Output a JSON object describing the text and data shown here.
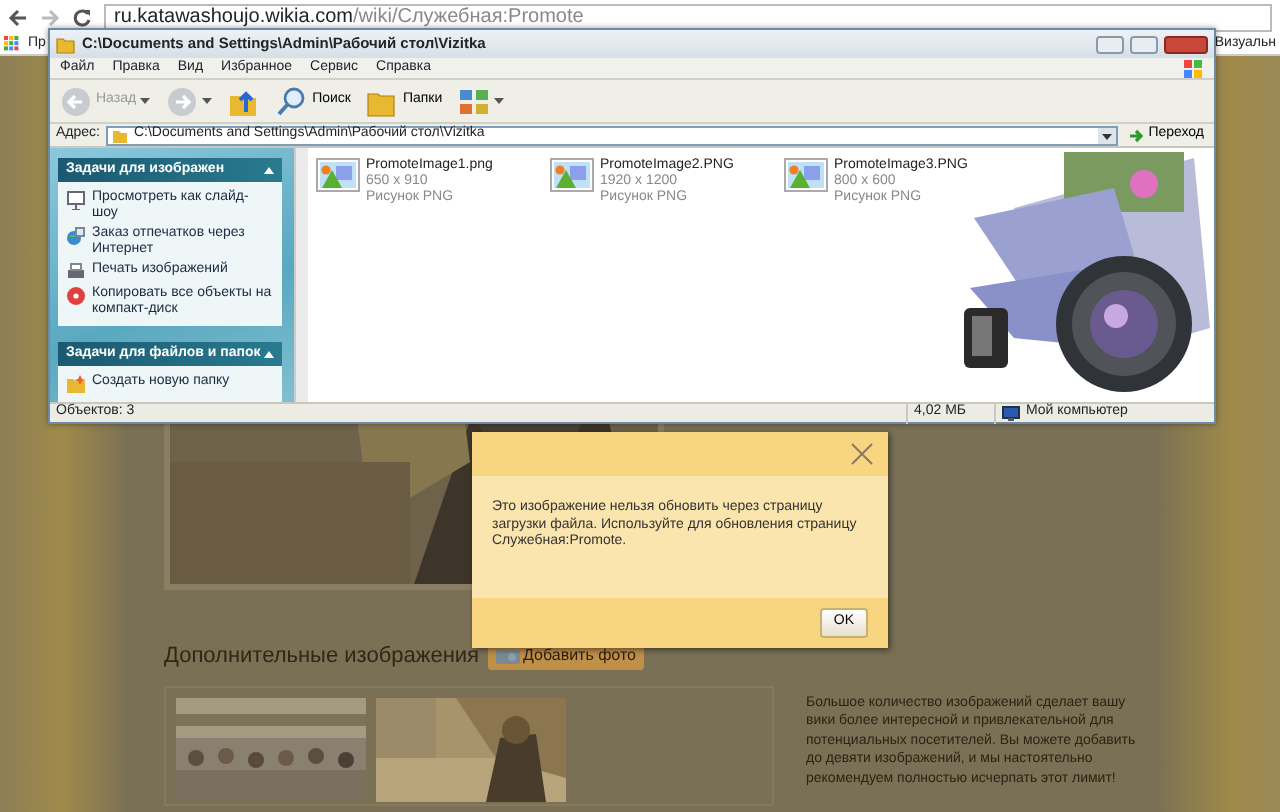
{
  "browser": {
    "url_host": "ru.katawashoujo.wikia.com",
    "url_path": "/wiki/Служебная:Promote",
    "bookmarks": [
      "Пр",
      "Визуальн"
    ]
  },
  "explorer": {
    "title": "C:\\Documents and Settings\\Admin\\Рабочий стол\\Vizitka",
    "menu": [
      "Файл",
      "Правка",
      "Вид",
      "Избранное",
      "Сервис",
      "Справка"
    ],
    "toolbar": [
      {
        "kind": "back",
        "label": "Назад",
        "disabled": true
      },
      {
        "kind": "forward",
        "disabled": true
      },
      {
        "kind": "up"
      },
      {
        "kind": "search",
        "label": "Поиск"
      },
      {
        "kind": "folders",
        "label": "Папки"
      },
      {
        "kind": "views"
      }
    ],
    "address": {
      "label": "Адрес:",
      "value": "C:\\Documents and Settings\\Admin\\Рабочий стол\\Vizitka",
      "go": "Переход"
    },
    "panels": [
      {
        "title": "Задачи для изображен",
        "expanded": true,
        "items": [
          {
            "kind": "slideshow",
            "label": "Просмотреть как слайд-шоу"
          },
          {
            "kind": "order",
            "label": "Заказ отпечатков через Интернет"
          },
          {
            "kind": "print",
            "label": "Печать изображений"
          },
          {
            "kind": "cd",
            "label": "Копировать все объекты на компакт-диск"
          }
        ]
      },
      {
        "title": "Задачи для файлов и папок",
        "expanded": true,
        "items": [
          {
            "kind": "newfolder",
            "label": "Создать новую папку"
          }
        ]
      }
    ],
    "files": [
      {
        "name": "PromoteImage1.png",
        "dims": "650 x 910",
        "type": "Рисунок PNG"
      },
      {
        "name": "PromoteImage2.PNG",
        "dims": "1920 x 1200",
        "type": "Рисунок PNG"
      },
      {
        "name": "PromoteImage3.PNG",
        "dims": "800 x 600",
        "type": "Рисунок PNG"
      }
    ],
    "status": {
      "objects": "Объектов: 3",
      "size": "4,02 МБ",
      "location": "Мой компьютер"
    }
  },
  "page": {
    "heading": "Дополнительные изображения",
    "add_button": "Добавить фото",
    "paragraph": "Большое количество изображений сделает вашу вики более интересной и привлекательной для потенциальных посетителей. Вы можете добавить до девяти изображений, и мы настоятельно рекомендуем полностью исчерпать этот лимит!"
  },
  "dialog": {
    "message": "Это изображение нельзя обновить через страницу загрузки файла. Используйте для обновления страницу Служебная:Promote.",
    "ok": "OK"
  }
}
